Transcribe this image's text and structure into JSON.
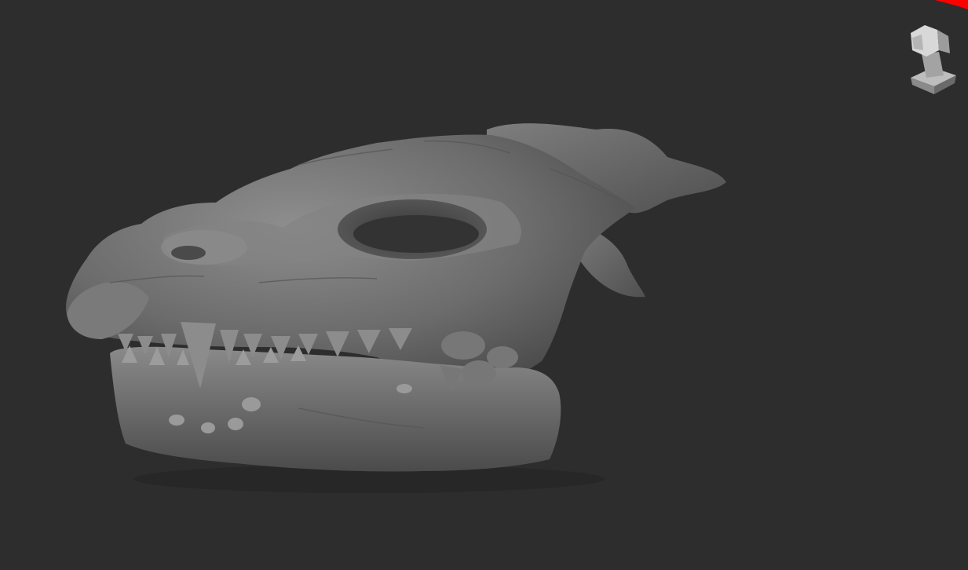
{
  "viewport": {
    "background_color": "#2d2d2d",
    "model": "dragon-skull-sculpt",
    "material_color": "#7a7a7a"
  },
  "nav_widget": {
    "icon": "head-orientation-icon"
  },
  "corner_marker": {
    "color": "#ff0000"
  }
}
